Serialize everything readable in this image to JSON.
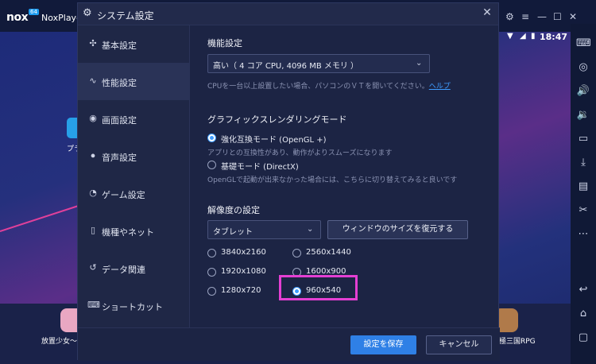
{
  "emulator": {
    "brand": "nox",
    "badge": "64",
    "app_name": "NoxPlayer",
    "status_time": "18:47",
    "left_app_label": "プラ",
    "bottom_apps": [
      {
        "label": "放置少女〜百"
      },
      {
        "label": "極三国RPG"
      }
    ]
  },
  "dialog": {
    "title": "システム設定",
    "nav": [
      {
        "label": "基本設定",
        "icon": "puzzle-icon"
      },
      {
        "label": "性能設定",
        "icon": "pulse-icon"
      },
      {
        "label": "画面設定",
        "icon": "palette-icon"
      },
      {
        "label": "音声設定",
        "icon": "sound-icon"
      },
      {
        "label": "ゲーム設定",
        "icon": "gamepad-icon"
      },
      {
        "label": "機種やネット",
        "icon": "phone-icon"
      },
      {
        "label": "データ関連",
        "icon": "history-icon"
      },
      {
        "label": "ショートカット",
        "icon": "keyboard-icon"
      }
    ],
    "active_nav_index": 1,
    "performance": {
      "heading": "機能設定",
      "selected": "高い（ 4 コア CPU, 4096 MB メモリ ）",
      "hint": "CPUを一台以上設置したい場合、パソコンのＶＴを開いてください。",
      "hint_link": "ヘルプ"
    },
    "graphics": {
      "heading": "グラフィックスレンダリングモード",
      "options": [
        {
          "label": "強化互換モード (OpenGL +)",
          "selected": true,
          "desc": "アプリとの互換性があり、動作がよりスムーズになります"
        },
        {
          "label": "基礎モード (DirectX)",
          "selected": false,
          "desc": "OpenGLで起動が出来なかった場合には、こちらに切り替えてみると良いです"
        }
      ]
    },
    "resolution": {
      "heading": "解像度の設定",
      "selected": "タブレット",
      "restore_button": "ウィンドウのサイズを復元する",
      "options": [
        {
          "label": "3840x2160",
          "selected": false
        },
        {
          "label": "2560x1440",
          "selected": false
        },
        {
          "label": "1920x1080",
          "selected": false
        },
        {
          "label": "1600x900",
          "selected": false
        },
        {
          "label": "1280x720",
          "selected": false
        },
        {
          "label": "960x540",
          "selected": true
        }
      ]
    },
    "footer": {
      "save": "設定を保存",
      "cancel": "キャンセル"
    }
  },
  "colors": {
    "accent": "#2f80e6",
    "highlight_box": "#e43fd3",
    "link": "#3f9cff"
  }
}
